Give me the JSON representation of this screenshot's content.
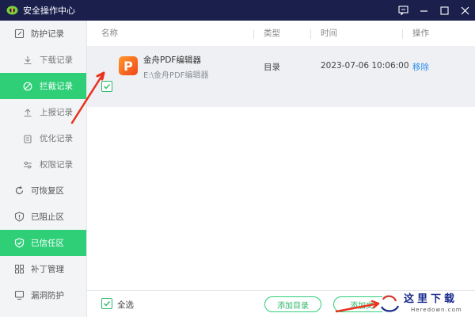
{
  "window": {
    "title": "安全操作中心",
    "controls": [
      "feedback-icon",
      "minimize-icon",
      "maximize-icon",
      "close-icon"
    ]
  },
  "sidebar": {
    "items": [
      {
        "label": "防护记录",
        "icon": "edit-icon",
        "level": "top"
      },
      {
        "label": "下载记录",
        "icon": "download-icon",
        "level": "sub"
      },
      {
        "label": "拦截记录",
        "icon": "block-icon",
        "level": "sub",
        "active": true
      },
      {
        "label": "上报记录",
        "icon": "upload-icon",
        "level": "sub"
      },
      {
        "label": "优化记录",
        "icon": "clipboard-icon",
        "level": "sub"
      },
      {
        "label": "权限记录",
        "icon": "sliders-icon",
        "level": "sub"
      },
      {
        "label": "可恢复区",
        "icon": "restore-icon",
        "level": "top"
      },
      {
        "label": "已阻止区",
        "icon": "shield-alert-icon",
        "level": "top"
      },
      {
        "label": "已信任区",
        "icon": "shield-check-icon",
        "level": "top",
        "active": true
      },
      {
        "label": "补丁管理",
        "icon": "grid-icon",
        "level": "top"
      },
      {
        "label": "漏洞防护",
        "icon": "monitor-icon",
        "level": "top"
      }
    ]
  },
  "table": {
    "columns": {
      "name": "名称",
      "type": "类型",
      "time": "时间",
      "action": "操作"
    },
    "rows": [
      {
        "name": "金舟PDF编辑器",
        "path": "E:\\金舟PDF编辑器",
        "type": "目录",
        "time": "2023-07-06 10:06:00",
        "action": "移除",
        "icon_letter": "P",
        "checked": true
      }
    ]
  },
  "footer": {
    "select_all": "全选",
    "add_dir": "添加目录",
    "add_file": "添加文"
  },
  "watermark": {
    "text": "这里下载",
    "url": "Heredown.com"
  },
  "colors": {
    "titlebar": "#1a1f4c",
    "accent": "#2fcf78",
    "link": "#2d8cf0",
    "annotation": "#e8321e"
  }
}
